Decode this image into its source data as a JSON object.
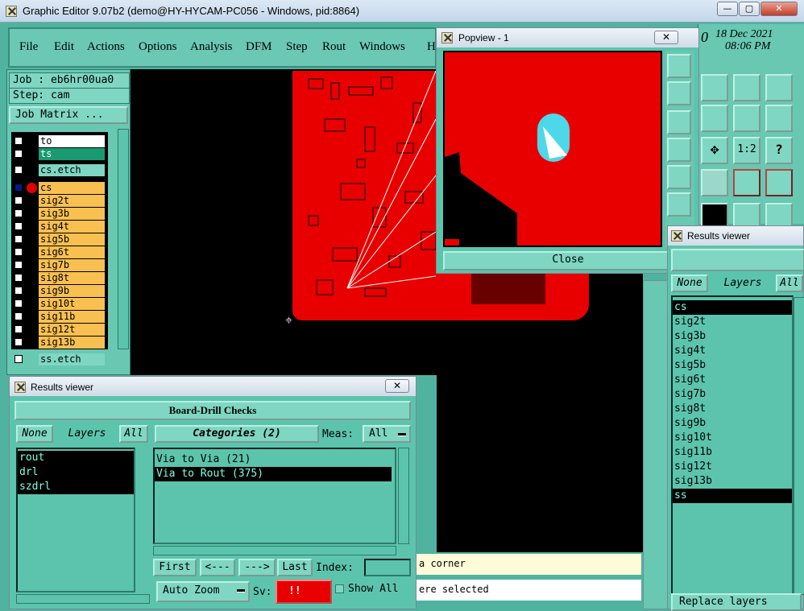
{
  "titlebar": {
    "title": "Graphic Editor 9.07b2 (demo@HY-HYCAM-PC056 - Windows, pid:8864)",
    "min": "—",
    "max": "▢",
    "close": "✕"
  },
  "menu": [
    "File",
    "Edit",
    "Actions",
    "Options",
    "Analysis",
    "DFM",
    "Step",
    "Rout",
    "Windows",
    "H"
  ],
  "job": {
    "job_label": "Job : eb6hr00ua0",
    "step_label": "Step: cam",
    "matrix_button": "Job Matrix ..."
  },
  "layers": {
    "top": [
      {
        "name": "to"
      },
      {
        "name": "ts"
      }
    ],
    "etch1": "cs.etch",
    "signal": [
      "cs",
      "sig2t",
      "sig3b",
      "sig4t",
      "sig5b",
      "sig6t",
      "sig7b",
      "sig8t",
      "sig9b",
      "sig10t",
      "sig11b",
      "sig12t",
      "sig13b"
    ],
    "etch2": "ss.etch"
  },
  "date": {
    "day": "18 Dec 2021",
    "time": "08:06 PM",
    "digit": "0"
  },
  "popview": {
    "title": "Popview - 1",
    "close_button": "Close"
  },
  "results_left": {
    "title": "Results viewer",
    "header": "Board-Drill Checks",
    "none_button": "None",
    "layers_label": "Layers",
    "all_button": "All",
    "layers": [
      "rout",
      "drl",
      "szdrl"
    ],
    "categories_label": "Categories (2)",
    "meas_label": "Meas:",
    "meas_value": "All",
    "categories": [
      "Via to Via  (21)",
      "Via to Rout  (375)"
    ],
    "first": "First",
    "prev": "<---",
    "next": "--->",
    "last": "Last",
    "index_label": "Index:",
    "auto_zoom": "Auto Zoom",
    "sv_label": "Sv:",
    "sv_value": "!!",
    "show_all": "Show All"
  },
  "results_right": {
    "title": "Results viewer",
    "none_button": "None",
    "layers_label": "Layers",
    "all_button": "All",
    "layers": [
      "cs",
      "sig2t",
      "sig3b",
      "sig4t",
      "sig5b",
      "sig6t",
      "sig7b",
      "sig8t",
      "sig9b",
      "sig10t",
      "sig11b",
      "sig12t",
      "sig13b",
      "ss"
    ],
    "replace_button": "Replace layers"
  },
  "messages": {
    "line1": "a corner",
    "line2": "ere selected"
  },
  "tools": {
    "ratio": "1:2",
    "help": "?"
  },
  "colors": {
    "board": "#e80000",
    "teal": "#5cc4ad",
    "layer_orange": "#f8c050",
    "layer_green": "#1a9a70"
  }
}
